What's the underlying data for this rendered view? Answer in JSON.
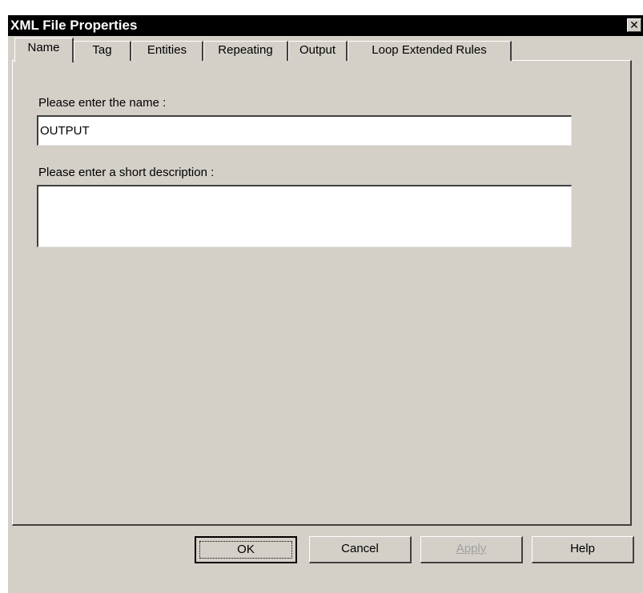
{
  "window": {
    "title": "XML File Properties",
    "close_glyph": "✕"
  },
  "tabs": [
    {
      "label": "Name",
      "active": true
    },
    {
      "label": "Tag",
      "active": false
    },
    {
      "label": "Entities",
      "active": false
    },
    {
      "label": "Repeating",
      "active": false
    },
    {
      "label": "Output",
      "active": false
    },
    {
      "label": "Loop Extended Rules",
      "active": false
    }
  ],
  "form": {
    "name_label": "Please enter the name :",
    "name_value": "OUTPUT",
    "description_label": "Please enter a short description :",
    "description_value": ""
  },
  "buttons": {
    "ok": "OK",
    "cancel": "Cancel",
    "apply": "Apply",
    "help": "Help"
  },
  "colors": {
    "titlebar": "#000000",
    "face": "#d4d0c8",
    "field": "#ffffff",
    "disabled_text": "#a0a0a0"
  }
}
